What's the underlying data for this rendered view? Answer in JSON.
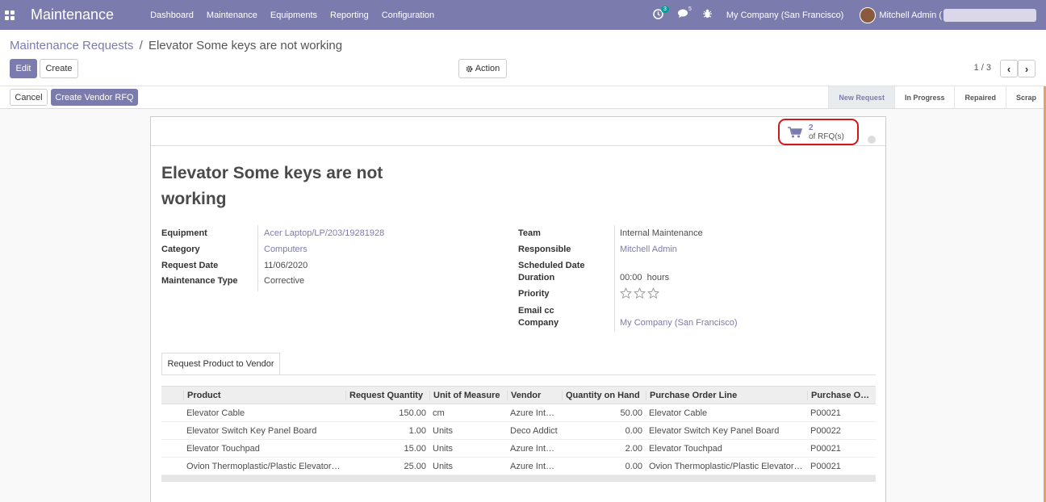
{
  "navbar": {
    "app_name": "Maintenance",
    "menu": [
      "Dashboard",
      "Maintenance",
      "Equipments",
      "Reporting",
      "Configuration"
    ],
    "activity_count": "3",
    "message_count": "5",
    "company": "My Company (San Francisco)",
    "user": "Mitchell Admin ("
  },
  "breadcrumb": {
    "parent": "Maintenance Requests",
    "separator": "/",
    "current": "Elevator Some keys are not working"
  },
  "buttons": {
    "edit": "Edit",
    "create": "Create",
    "action": "Action",
    "cancel": "Cancel",
    "create_vendor_rfq": "Create Vendor RFQ"
  },
  "pager": {
    "value": "1 / 3",
    "prev": "‹",
    "next": "›"
  },
  "stages": [
    "New Request",
    "In Progress",
    "Repaired",
    "Scrap"
  ],
  "active_stage": "New Request",
  "smart_button": {
    "count": "2",
    "label": "of RFQ(s)"
  },
  "record": {
    "title": "Elevator Some keys are not working",
    "left": [
      {
        "label": "Equipment",
        "value": "Acer Laptop/LP/203/19281928",
        "link": true
      },
      {
        "label": "Category",
        "value": "Computers",
        "link": true
      },
      {
        "label": "Request Date",
        "value": "11/06/2020",
        "link": false
      },
      {
        "label": "Maintenance Type",
        "value": "Corrective",
        "link": false
      }
    ],
    "right": {
      "team_label": "Team",
      "team": "Internal Maintenance",
      "responsible_label": "Responsible",
      "responsible": "Mitchell Admin",
      "scheduled_label": "Scheduled Date",
      "duration_label": "Duration",
      "duration": "00:00",
      "duration_unit": "hours",
      "priority_label": "Priority",
      "priority_stars": 0,
      "priority_max": 3,
      "email_cc_label": "Email cc",
      "company_label": "Company",
      "company": "My Company (San Francisco)"
    }
  },
  "tab": {
    "label": "Request Product to Vendor"
  },
  "table": {
    "columns": [
      "Product",
      "Request Quantity",
      "Unit of Measure",
      "Vendor",
      "Quantity on Hand",
      "Purchase Order Line",
      "Purchase Or…"
    ],
    "rows": [
      [
        "Elevator Cable",
        "150.00",
        "cm",
        "Azure Inter…",
        "50.00",
        "Elevator Cable",
        "P00021"
      ],
      [
        "Elevator Switch Key Panel Board",
        "1.00",
        "Units",
        "Deco Addict",
        "0.00",
        "Elevator Switch Key Panel Board",
        "P00022"
      ],
      [
        "Elevator Touchpad",
        "15.00",
        "Units",
        "Azure Inter…",
        "2.00",
        "Elevator Touchpad",
        "P00021"
      ],
      [
        "Ovion Thermoplastic/Plastic Elevator S…",
        "25.00",
        "Units",
        "Azure Inter…",
        "0.00",
        "Ovion Thermoplastic/Plastic Elevator S…",
        "P00021"
      ]
    ]
  },
  "colors": {
    "brand": "#7c7bad",
    "highlight": "#d01919",
    "accent": "#e6a06b"
  }
}
